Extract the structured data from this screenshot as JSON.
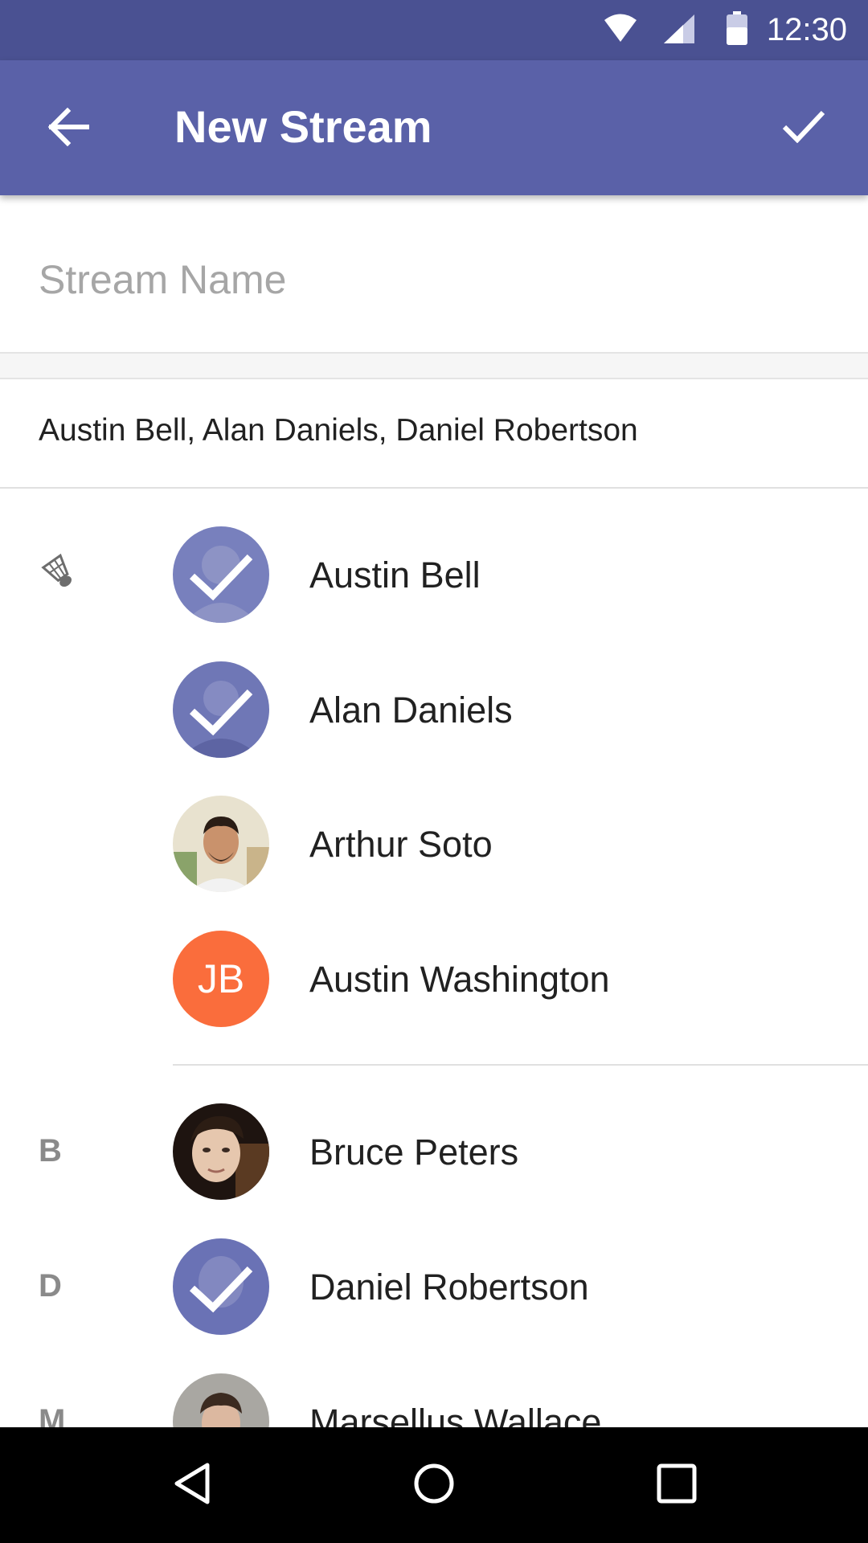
{
  "status_bar": {
    "time": "12:30",
    "icons": [
      "wifi-icon",
      "cell-signal-icon",
      "battery-icon"
    ]
  },
  "app_bar": {
    "title": "New Stream",
    "back_icon": "arrow-back-icon",
    "confirm_icon": "checkmark-icon",
    "background": "#5a61a8"
  },
  "stream_name": {
    "value": "",
    "placeholder": "Stream Name"
  },
  "selected_summary": "Austin Bell, Alan Daniels, Daniel Robertson",
  "section_icon": "shuttlecock-icon",
  "contacts": [
    {
      "name": "Austin Bell",
      "selected": true,
      "section": ""
    },
    {
      "name": "Alan Daniels",
      "selected": true,
      "section": ""
    },
    {
      "name": "Arthur Soto",
      "selected": false,
      "section": ""
    },
    {
      "name": "Austin Washington",
      "selected": false,
      "section": "",
      "initials": "JB",
      "initials_color": "#fa6d3c"
    },
    {
      "name": "Bruce Peters",
      "selected": false,
      "section": "B"
    },
    {
      "name": "Daniel Robertson",
      "selected": true,
      "section": "D"
    },
    {
      "name": "Marsellus Wallace",
      "selected": false,
      "section": "M"
    }
  ],
  "nav_bar": {
    "buttons": [
      "back-triangle-icon",
      "home-circle-icon",
      "recents-square-icon"
    ]
  },
  "colors": {
    "status_bar": "#4a5192",
    "selected_overlay": "#6b73b6",
    "section_letter": "#8a8a8a"
  }
}
